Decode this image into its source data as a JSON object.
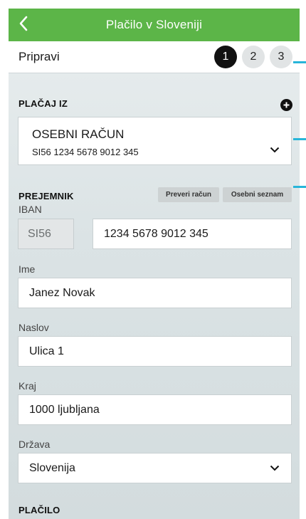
{
  "header": {
    "title": "Plačilo v Sloveniji",
    "back_icon": "chevron-left-icon"
  },
  "steps": {
    "label": "Pripravi",
    "items": [
      "1",
      "2",
      "3"
    ],
    "active": "1"
  },
  "payer": {
    "section_title": "PLAČAJ IZ",
    "add_icon": "plus-circle-icon",
    "account_name": "OSEBNI RAČUN",
    "account_iban": "SI56 1234 5678 9012 345"
  },
  "recipient": {
    "section_title": "PREJEMNIK",
    "check_account": "Preveri račun",
    "personal_list": "Osebni seznam",
    "iban_label": "IBAN",
    "iban_prefix": "SI56",
    "iban_value": "1234 5678 9012 345",
    "name_label": "Ime",
    "name_value": "Janez Novak",
    "address_label": "Naslov",
    "address_value": "Ulica 1",
    "city_label": "Kraj",
    "city_value": "1000 ljubljana",
    "country_label": "Država",
    "country_value": "Slovenija"
  },
  "payment": {
    "section_title": "PLAČILO"
  },
  "colors": {
    "accent": "#5cb548",
    "annotation": "#27b5d9",
    "active_step": "#111111"
  }
}
